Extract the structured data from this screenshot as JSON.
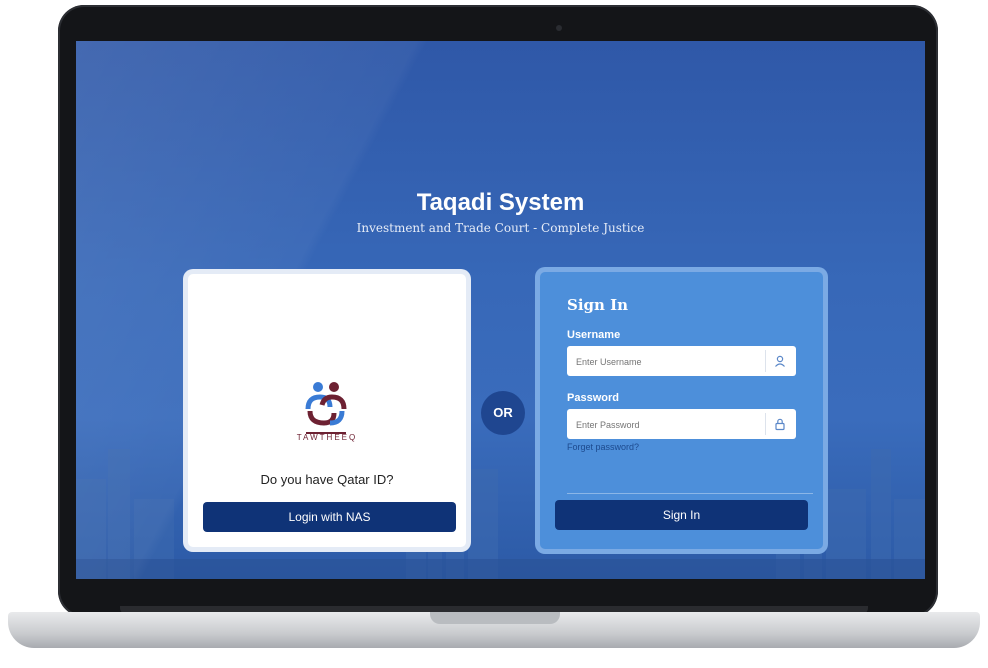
{
  "app": {
    "title": "Taqadi System",
    "subtitle": "Investment and Trade Court - Complete Justice"
  },
  "nas_panel": {
    "logo_text": "TAWTHEEQ",
    "question": "Do you have Qatar ID?",
    "login_button": "Login with NAS"
  },
  "separator": {
    "label": "OR"
  },
  "signin_panel": {
    "title": "Sign In",
    "username_label": "Username",
    "username_placeholder": "Enter Username",
    "username_icon": "user-icon",
    "password_label": "Password",
    "password_placeholder": "Enter Password",
    "password_icon": "lock-icon",
    "forgot_link": "Forget password?",
    "signin_button": "Sign In"
  },
  "colors": {
    "background_blue": "#3768b8",
    "panel_blue": "#4d8fda",
    "button_navy": "#0f3377",
    "logo_blue": "#3a7bd5",
    "logo_maroon": "#6d2132"
  }
}
